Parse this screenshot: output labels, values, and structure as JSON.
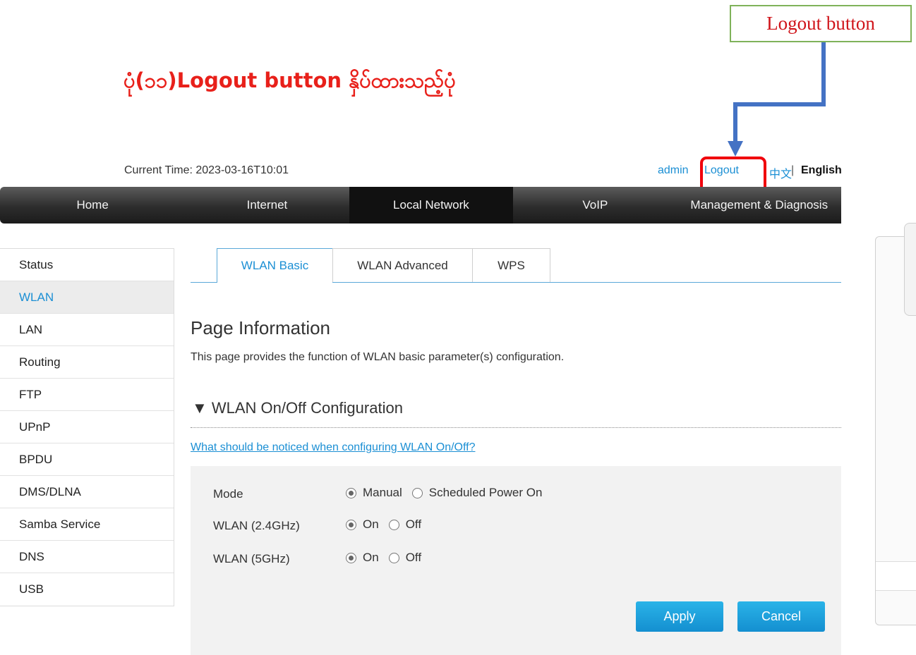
{
  "annotation": {
    "title": "ပုံ(၁၁)Logout button နှိပ်ထားသည့်ပုံ",
    "callout_label": "Logout button"
  },
  "header": {
    "current_time": "Current Time: 2023-03-16T10:01",
    "user": "admin",
    "logout": "Logout",
    "lang_zh": "中文",
    "lang_sep": "|",
    "lang_en": "English"
  },
  "nav": {
    "items": [
      "Home",
      "Internet",
      "Local Network",
      "VoIP",
      "Management & Diagnosis"
    ],
    "active": "Local Network"
  },
  "sidebar": {
    "items": [
      "Status",
      "WLAN",
      "LAN",
      "Routing",
      "FTP",
      "UPnP",
      "BPDU",
      "DMS/DLNA",
      "Samba Service",
      "DNS",
      "USB"
    ],
    "active": "WLAN"
  },
  "tabs": {
    "items": [
      "WLAN Basic",
      "WLAN Advanced",
      "WPS"
    ],
    "active": "WLAN Basic"
  },
  "page": {
    "info_title": "Page Information",
    "info_desc": "This page provides the function of WLAN basic parameter(s) configuration.",
    "section_title": "▼  WLAN On/Off Configuration",
    "notice_link": "What should be noticed when configuring WLAN On/Off?"
  },
  "form": {
    "mode": {
      "label": "Mode",
      "options": [
        "Manual",
        "Scheduled Power On"
      ],
      "selected": "Manual"
    },
    "wlan24": {
      "label": "WLAN (2.4GHz)",
      "options": [
        "On",
        "Off"
      ],
      "selected": "On"
    },
    "wlan5": {
      "label": "WLAN (5GHz)",
      "options": [
        "On",
        "Off"
      ],
      "selected": "On"
    }
  },
  "buttons": {
    "apply": "Apply",
    "cancel": "Cancel"
  },
  "colors": {
    "accent": "#1b8fd4",
    "annotation_red": "#e8201a",
    "arrow_blue": "#4472c4"
  }
}
